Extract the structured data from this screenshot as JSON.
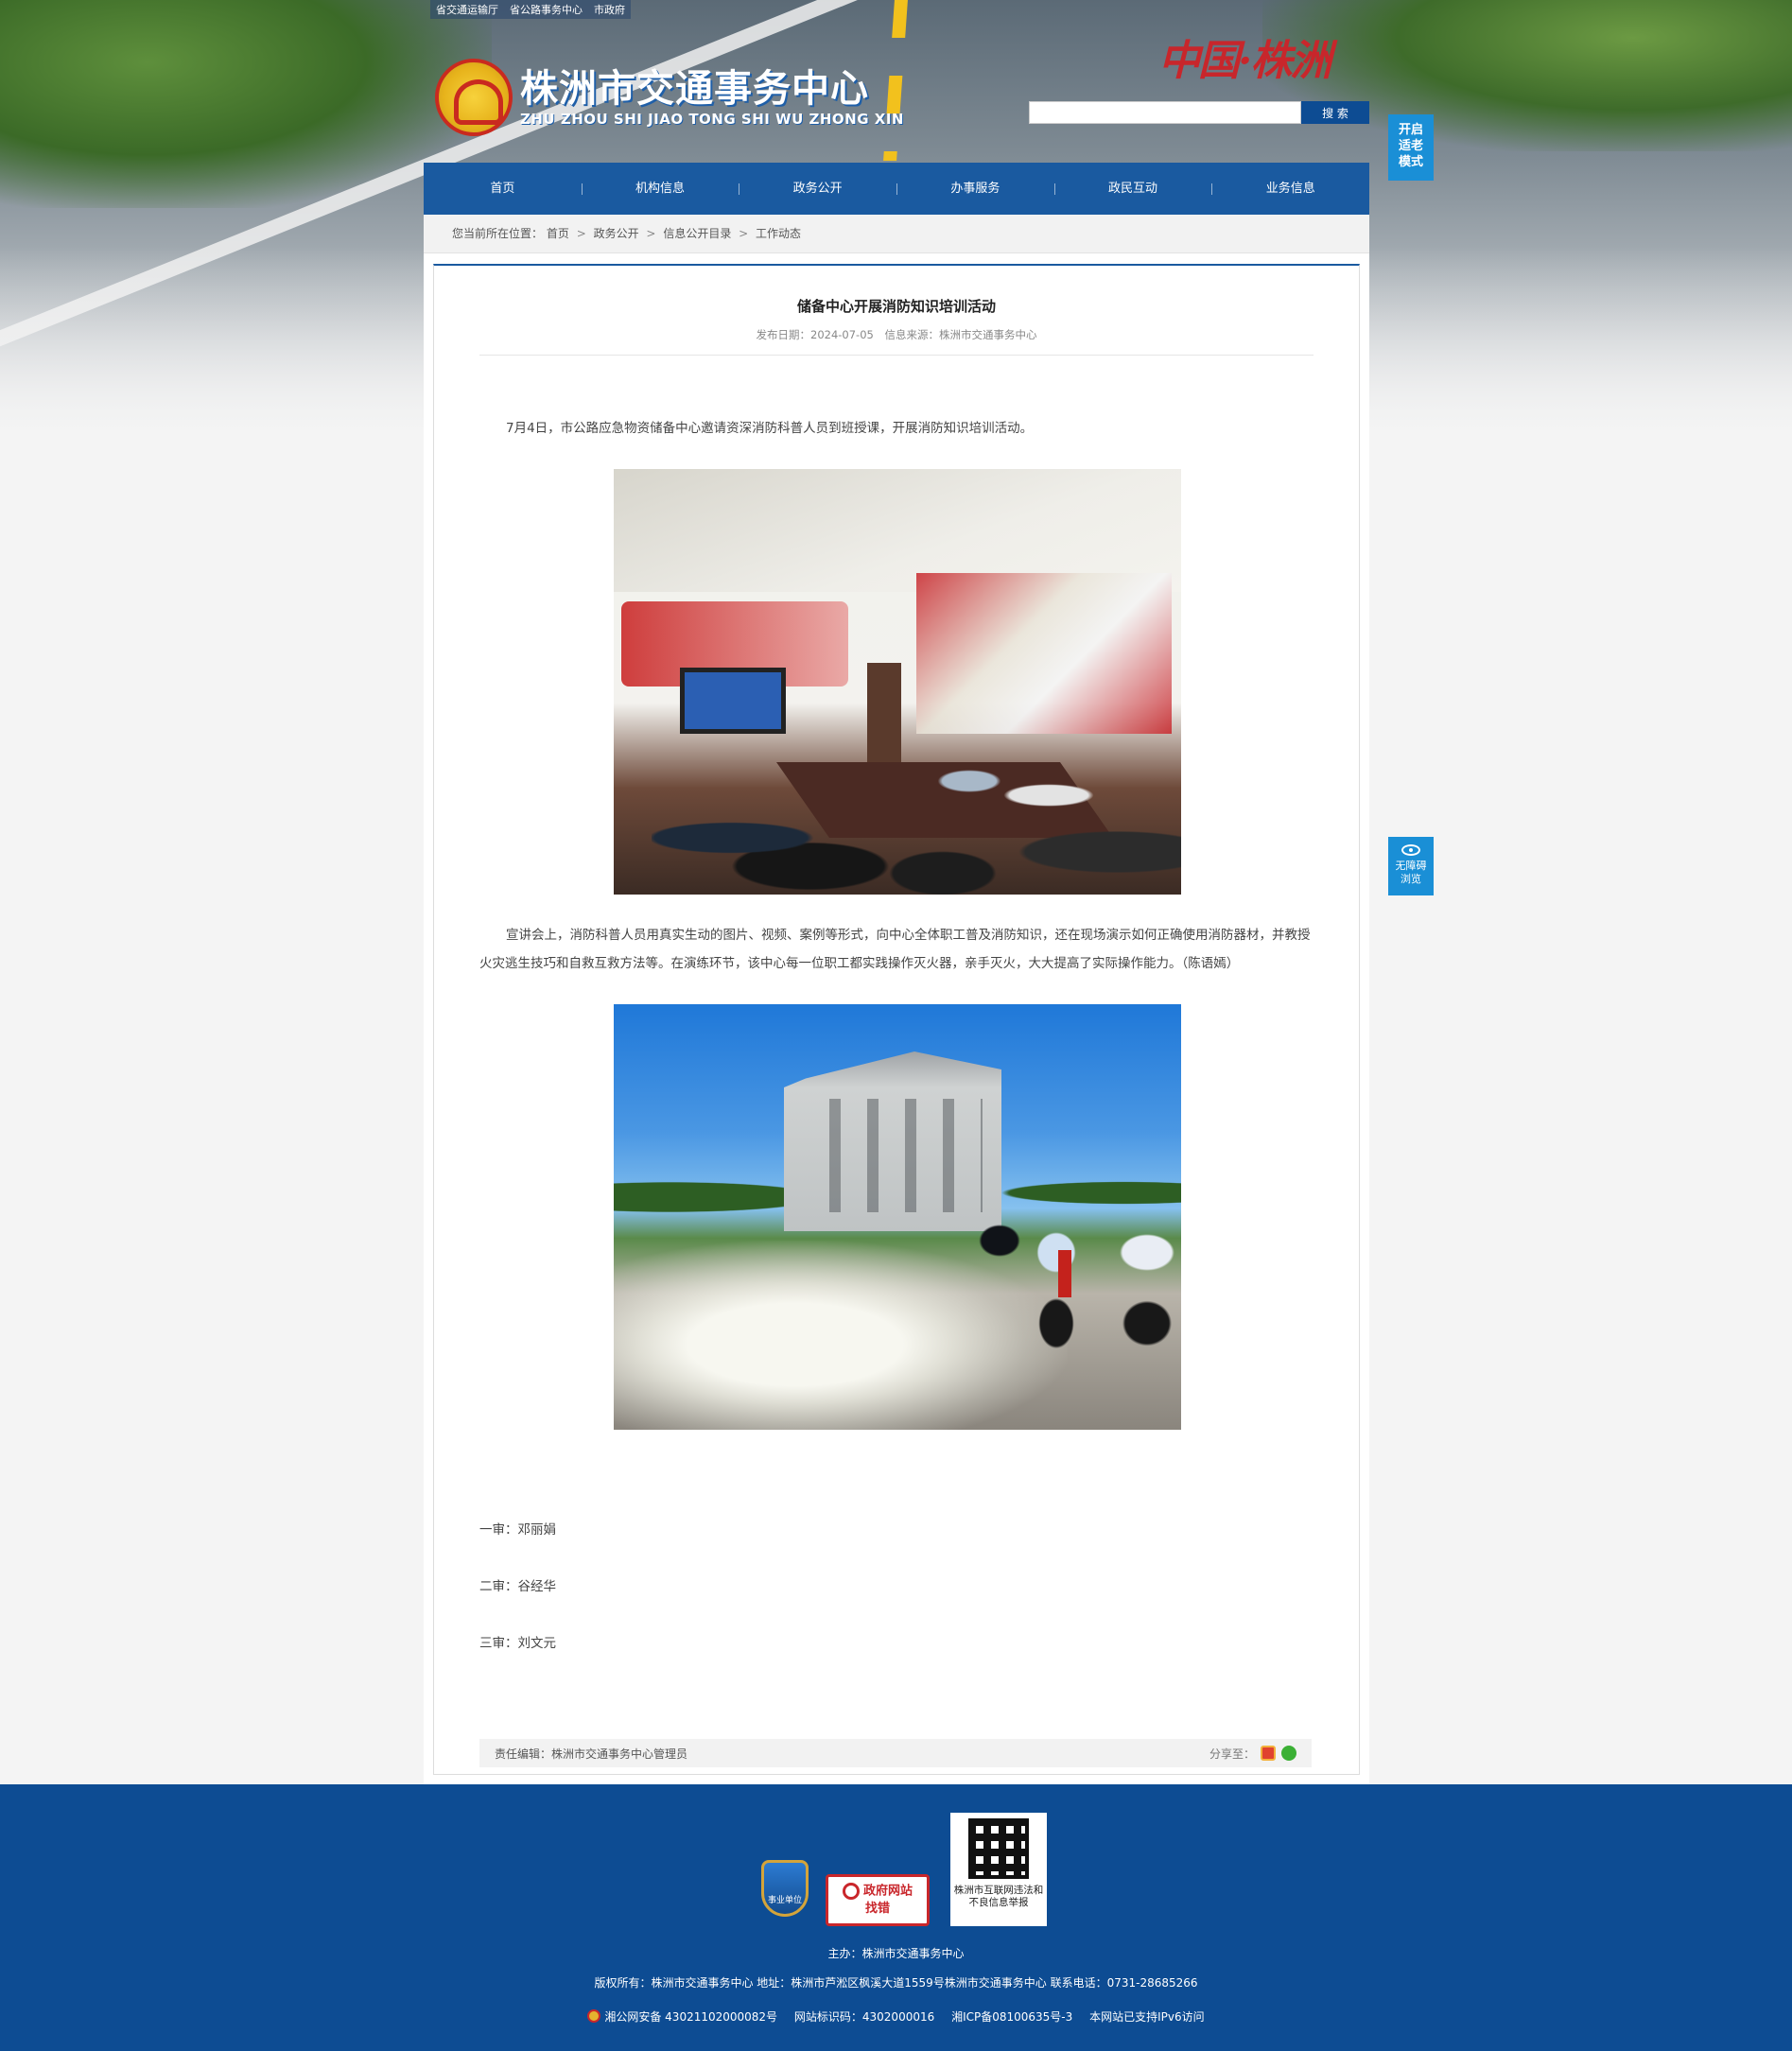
{
  "top_links": [
    "省交通运输厅",
    "省公路事务中心",
    "市政府"
  ],
  "logo": {
    "cn": "株洲市交通事务中心",
    "en": "ZHU ZHOU SHI  JIAO TONG SHI WU ZHONG XIN"
  },
  "calligraphy": "中国·株洲",
  "search": {
    "placeholder": "",
    "button": "搜 索"
  },
  "side_buttons": {
    "elder_mode": "开启适老模式",
    "accessible": "无障碍浏览"
  },
  "nav": [
    "首页",
    "机构信息",
    "政务公开",
    "办事服务",
    "政民互动",
    "业务信息"
  ],
  "breadcrumb": {
    "prefix": "您当前所在位置：",
    "items": [
      "首页",
      "政务公开",
      "信息公开目录",
      "工作动态"
    ],
    "separator": ">"
  },
  "article": {
    "title": "储备中心开展消防知识培训活动",
    "date": "发布日期：2024-07-05",
    "source": "信息来源：株洲市交通事务中心",
    "paragraph1": "7月4日，市公路应急物资储备中心邀请资深消防科普人员到班授课，开展消防知识培训活动。",
    "paragraph2": "宣讲会上，消防科普人员用真实生动的图片、视频、案例等形式，向中心全体职工普及消防知识，还在现场演示如何正确使用消防器材，并教授火灾逃生技巧和自救互救方法等。在演练环节，该中心每一位职工都实践操作灭火器，亲手灭火，大大提高了实际操作能力。（陈语嫣）",
    "review1": "一审：邓丽娟",
    "review2": "二审：谷经华",
    "review3": "三审：刘文元",
    "editor": "责任编辑：株洲市交通事务中心管理员",
    "share_label": "分享至："
  },
  "footer": {
    "badge_shield": "事业单位",
    "badge_report_line1": "政府网站",
    "badge_report_line2": "找错",
    "qr_caption": "株洲市互联网违法和不良信息举报",
    "host": "主办：株洲市交通事务中心",
    "copyright": "版权所有：株洲市交通事务中心 地址：株洲市芦淞区枫溪大道1559号株洲市交通事务中心 联系电话：0731-28685266",
    "police": "湘公网安备 43021102000082号",
    "site_id": "网站标识码：4302000016",
    "icp": "湘ICP备08100635号-3",
    "ipv6": "本网站已支持IPv6访问"
  },
  "colors": {
    "nav_bg": "#1a5aa0",
    "footer_bg": "#0d4c93",
    "accent_blue": "#1a8fd6",
    "brand_red": "#c8262b"
  }
}
